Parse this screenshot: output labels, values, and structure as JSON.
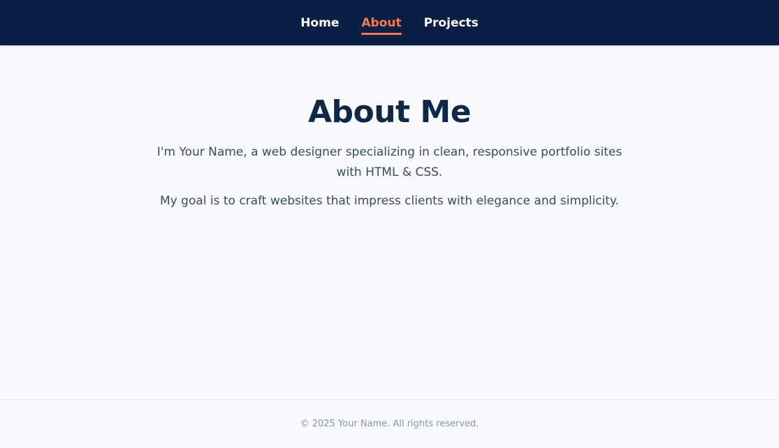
{
  "nav": {
    "items": [
      {
        "label": "Home",
        "active": false
      },
      {
        "label": "About",
        "active": true
      },
      {
        "label": "Projects",
        "active": false
      }
    ]
  },
  "main": {
    "title": "About Me",
    "paragraph1": "I'm Your Name, a web designer specializing in clean, responsive portfolio sites with HTML & CSS.",
    "paragraph2": "My goal is to craft websites that impress clients with elegance and simplicity."
  },
  "footer": {
    "text": "© 2025 Your Name. All rights reserved."
  },
  "colors": {
    "nav_background": "#0b1f45",
    "accent": "#f27a54",
    "page_background": "#f8faff",
    "heading": "#0e2846"
  }
}
